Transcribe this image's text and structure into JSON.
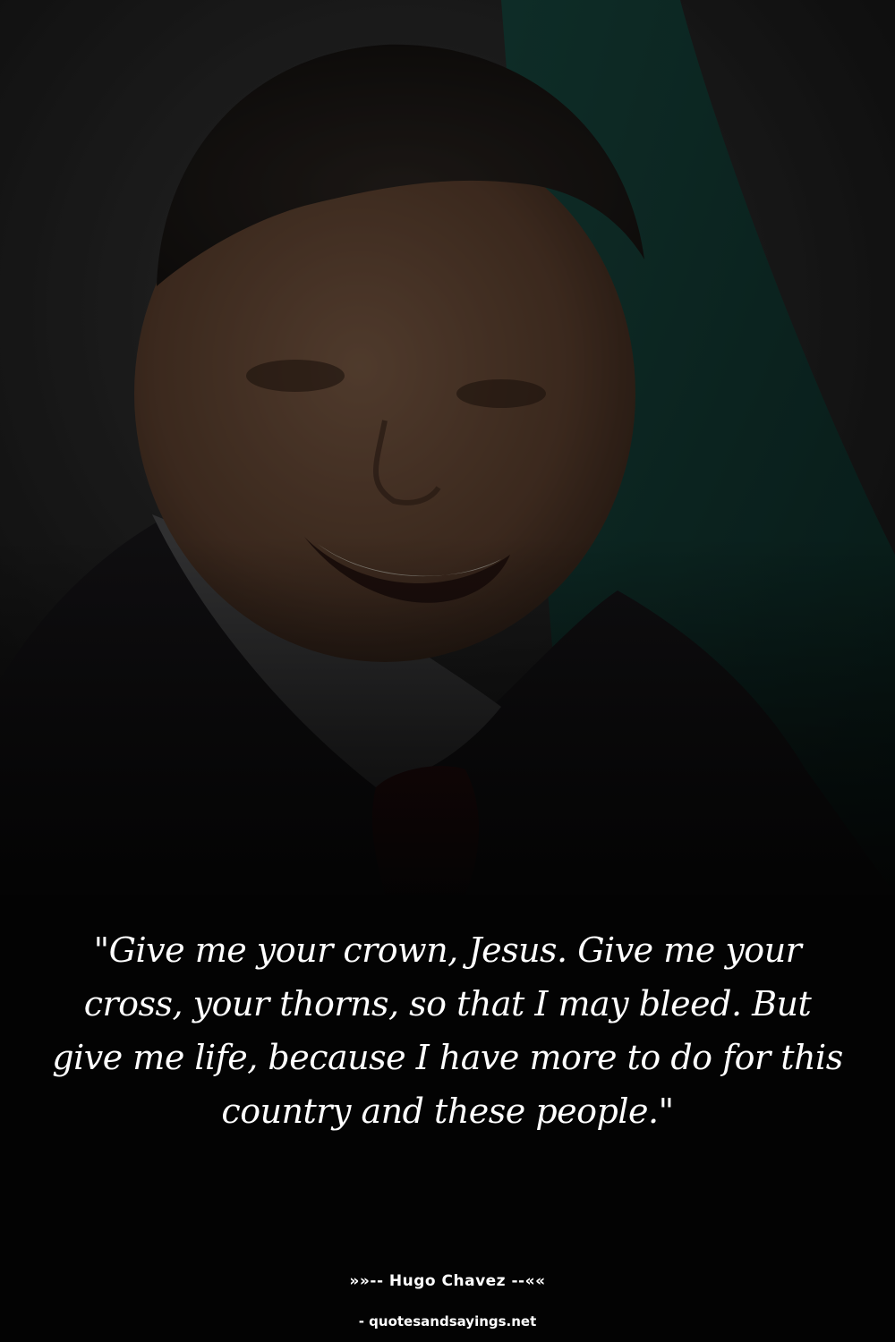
{
  "quote": {
    "text": "\"Give me your crown, Jesus. Give me your cross, your thorns, so that I may bleed. But give me life, because I have more to do for this country and these people.\""
  },
  "author": {
    "line": "»»-- Hugo Chavez --««"
  },
  "source": {
    "text": "- quotesandsayings.net"
  },
  "colors": {
    "background": "#030303",
    "text": "#ffffff",
    "flag_green": "#0f3a33",
    "suit": "#17161a"
  }
}
